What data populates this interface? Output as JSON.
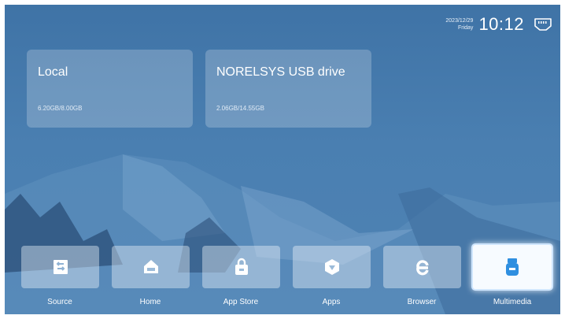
{
  "status_bar": {
    "date": "2023/12/29",
    "weekday": "Friday",
    "time": "10:12",
    "network_icon": "ethernet-icon"
  },
  "storage": [
    {
      "name": "Local",
      "usage": "6.20GB/8.00GB"
    },
    {
      "name": "NORELSYS USB drive",
      "usage": "2.06GB/14.55GB"
    }
  ],
  "dock": {
    "items": [
      {
        "label": "Source",
        "icon": "source-icon"
      },
      {
        "label": "Home",
        "icon": "home-icon"
      },
      {
        "label": "App Store",
        "icon": "app-store-icon"
      },
      {
        "label": "Apps",
        "icon": "apps-icon"
      },
      {
        "label": "Browser",
        "icon": "browser-icon"
      },
      {
        "label": "Multimedia",
        "icon": "multimedia-icon",
        "selected": true
      }
    ]
  },
  "colors": {
    "background": "#4a7fb1",
    "accent": "#2f8fe0",
    "mountains_dark": "#2b4f78"
  }
}
